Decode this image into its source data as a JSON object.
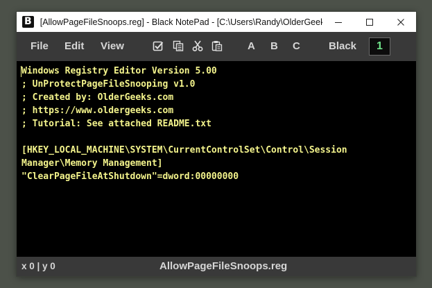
{
  "window": {
    "app_icon_letter": "B",
    "title": "[AllowPageFileSnoops.reg] - Black NotePad - [C:\\Users\\Randy\\OlderGeeks\\...",
    "controls": [
      "minimize-icon",
      "maximize-icon",
      "close-icon"
    ]
  },
  "menu": {
    "file": "File",
    "edit": "Edit",
    "view": "View"
  },
  "toolbar": {
    "icons": [
      "select-all-icon",
      "copy-icon",
      "cut-icon",
      "paste-icon"
    ],
    "font_a": "A",
    "font_b": "B",
    "font_c": "C",
    "theme": "Black",
    "font_size": "1"
  },
  "editor": {
    "lines": [
      "Windows Registry Editor Version 5.00",
      "; UnProtectPageFileSnooping v1.0",
      "; Created by: OlderGeeks.com",
      "; https://www.oldergeeks.com",
      "; Tutorial: See attached README.txt",
      "",
      "[HKEY_LOCAL_MACHINE\\SYSTEM\\CurrentControlSet\\Control\\Session",
      "Manager\\Memory Management]",
      "\"ClearPageFileAtShutdown\"=dword:00000000"
    ]
  },
  "status": {
    "position": "x 0 | y 0",
    "filename": "AllowPageFileSnoops.reg"
  },
  "colors": {
    "background": "#4c5149",
    "bar": "#393939",
    "editor_bg": "#000000",
    "text": "#f4f48c",
    "accent_green": "#6fe38a"
  }
}
